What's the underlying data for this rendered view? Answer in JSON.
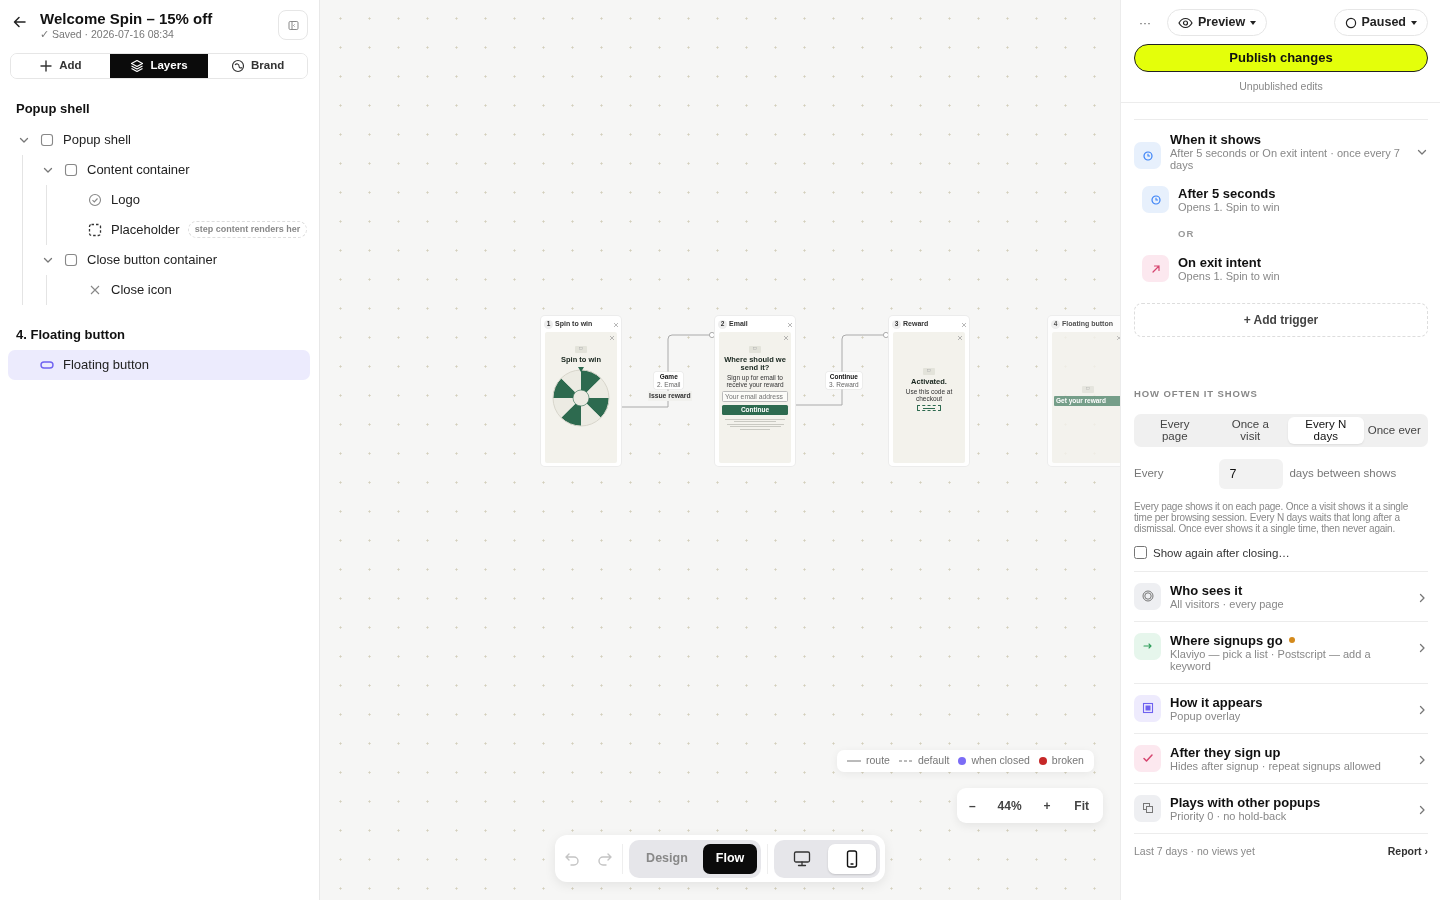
{
  "header": {
    "title": "Welcome Spin – 15% off",
    "status": "✓ Saved · 2026-07-16 08:34"
  },
  "tabs": [
    {
      "label": "Add",
      "kind": "add",
      "selected": false
    },
    {
      "label": "Layers",
      "kind": "layers",
      "selected": true
    },
    {
      "label": "Brand",
      "kind": "brand",
      "selected": false
    }
  ],
  "layer_sections": [
    {
      "title": "Popup shell",
      "items": [
        {
          "label": "Popup shell",
          "kind": "container",
          "expanded": true,
          "selected": false,
          "children": [
            {
              "label": "Content container",
              "kind": "container",
              "expanded": true,
              "selected": false,
              "children": [
                {
                  "label": "Logo",
                  "kind": "logo",
                  "selected": false
                },
                {
                  "label": "Placeholder",
                  "kind": "placeholder",
                  "badge": "step content renders her",
                  "selected": false
                }
              ]
            },
            {
              "label": "Close button container",
              "kind": "container",
              "expanded": true,
              "selected": false,
              "children": [
                {
                  "label": "Close icon",
                  "kind": "close",
                  "selected": false
                }
              ]
            }
          ]
        }
      ]
    },
    {
      "title": "4. Floating button",
      "items": [
        {
          "label": "Floating button",
          "kind": "button",
          "selected": true
        }
      ]
    }
  ],
  "flow": {
    "steps": [
      {
        "number": "1",
        "name": "Spin to win",
        "kind": "wheel",
        "heading": "Spin to win"
      },
      {
        "number": "2",
        "name": "Email",
        "kind": "form",
        "heading": "Where should we send it?",
        "sub": "Sign up for email to receive your reward",
        "placeholder": "Your email address",
        "button": "Continue"
      },
      {
        "number": "3",
        "name": "Reward",
        "kind": "reward",
        "heading": "Activated.",
        "sub": "Use this code at checkout"
      },
      {
        "number": "4",
        "name": "Floating button",
        "kind": "floating",
        "button": "Get your reward"
      }
    ],
    "connectors": [
      {
        "label": "Game",
        "target": "2. Email",
        "action": "Issue reward"
      },
      {
        "label": "Continue",
        "target": "3. Reward"
      }
    ]
  },
  "legend": [
    {
      "label": "route",
      "kind": "solid"
    },
    {
      "label": "default",
      "kind": "dashed"
    },
    {
      "label": "when closed",
      "kind": "dot",
      "color": "#7b6cf6"
    },
    {
      "label": "broken",
      "kind": "dot",
      "color": "#c62828"
    }
  ],
  "zoom": {
    "minus": "–",
    "value": "44%",
    "plus": "+",
    "fit": "Fit"
  },
  "toolbar": {
    "history": [
      {
        "kind": "undo",
        "disabled": true
      },
      {
        "kind": "redo",
        "disabled": true
      }
    ],
    "modes": [
      {
        "label": "Design",
        "selected": false
      },
      {
        "label": "Flow",
        "selected": true
      }
    ],
    "devices": [
      {
        "kind": "desktop",
        "selected": false
      },
      {
        "kind": "mobile",
        "selected": true
      }
    ]
  },
  "top_bar": {
    "more": "···",
    "preview": "Preview",
    "status": "Paused"
  },
  "publish": {
    "label": "Publish changes",
    "note": "Unpublished edits"
  },
  "when": {
    "title": "When it shows",
    "summary": "After 5 seconds or On exit intent · once every 7 days",
    "expanded": true,
    "triggers": [
      {
        "kind": "timer",
        "title": "After 5 seconds",
        "sub": "Opens 1. Spin to win"
      },
      {
        "kind": "exit",
        "title": "On exit intent",
        "sub": "Opens 1. Spin to win"
      }
    ],
    "separator": "OR",
    "add": "+ Add trigger"
  },
  "frequency": {
    "heading": "HOW OFTEN IT SHOWS",
    "options": [
      {
        "label": "Every page",
        "selected": false
      },
      {
        "label": "Once a visit",
        "selected": false
      },
      {
        "label": "Every N days",
        "selected": true
      },
      {
        "label": "Once ever",
        "selected": false
      }
    ],
    "every_label": "Every",
    "days": "7",
    "days_label": "days between shows",
    "help": "Every page shows it on each page. Once a visit shows it a single time per browsing session. Every N days waits that long after a dismissal. Once ever shows it a single time, then never again.",
    "show_again": {
      "label": "Show again after closing…",
      "checked": false
    }
  },
  "settings": [
    {
      "kind": "audience",
      "title": "Who sees it",
      "sub": "All visitors · every page",
      "needs_attention": false
    },
    {
      "kind": "destination",
      "title": "Where signups go",
      "sub": "Klaviyo — pick a list · Postscript — add a keyword",
      "needs_attention": true
    },
    {
      "kind": "appearance",
      "title": "How it appears",
      "sub": "Popup overlay",
      "needs_attention": false
    },
    {
      "kind": "after",
      "title": "After they sign up",
      "sub": "Hides after signup · repeat signups allowed",
      "needs_attention": false
    },
    {
      "kind": "priority",
      "title": "Plays with other popups",
      "sub": "Priority 0 · no hold-back",
      "needs_attention": false
    }
  ],
  "footer": {
    "stats": "Last 7 days · no views yet",
    "link": "Report ›"
  }
}
